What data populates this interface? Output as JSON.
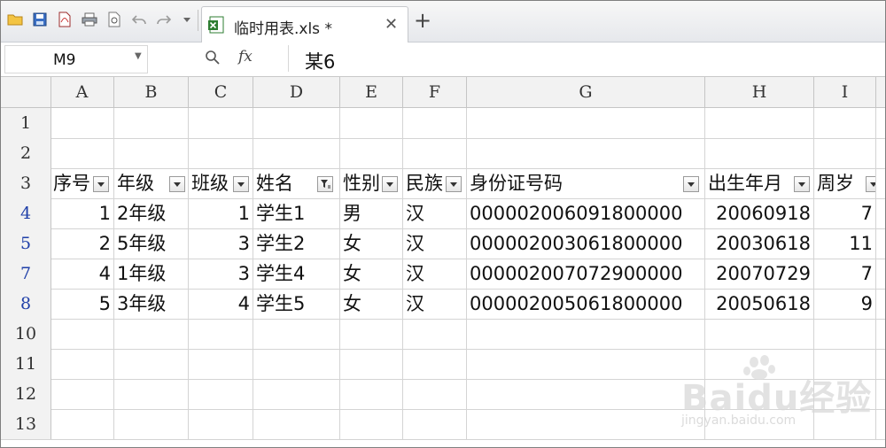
{
  "window": {
    "document_tab": "临时用表.xls *",
    "new_tab_symbol": "+",
    "close_symbol": "✕"
  },
  "formula_bar": {
    "name_box": "M9",
    "fx_label": "fx",
    "formula_value": "某6"
  },
  "columns": [
    "A",
    "B",
    "C",
    "D",
    "E",
    "F",
    "G",
    "H",
    "I"
  ],
  "header_row": {
    "row_number": "3",
    "cells": [
      "序号",
      "年级",
      "班级",
      "姓名",
      "性别",
      "民族",
      "身份证号码",
      "出生年月",
      "周岁"
    ]
  },
  "empty_rows_top": [
    "1",
    "2"
  ],
  "data_rows": [
    {
      "row_number": "4",
      "cells": [
        "1",
        "2年级",
        "1",
        "学生1",
        "男",
        "汉",
        "000002006091800000",
        "20060918",
        "7"
      ]
    },
    {
      "row_number": "5",
      "cells": [
        "2",
        "5年级",
        "3",
        "学生2",
        "女",
        "汉",
        "000002003061800000",
        "20030618",
        "11"
      ]
    },
    {
      "row_number": "7",
      "cells": [
        "4",
        "1年级",
        "3",
        "学生4",
        "女",
        "汉",
        "000002007072900000",
        "20070729",
        "7"
      ]
    },
    {
      "row_number": "8",
      "cells": [
        "5",
        "3年级",
        "4",
        "学生5",
        "女",
        "汉",
        "000002005061800000",
        "20050618",
        "9"
      ]
    }
  ],
  "empty_rows_bottom": [
    "10",
    "11",
    "12",
    "13"
  ],
  "watermark": {
    "brand": "Baidu经验",
    "url": "jingyan.baidu.com"
  },
  "colors": {
    "filtered_row_number": "#1f3fa8",
    "header_bg": "#f2f2f2",
    "grid_line": "#d4d4d4"
  }
}
